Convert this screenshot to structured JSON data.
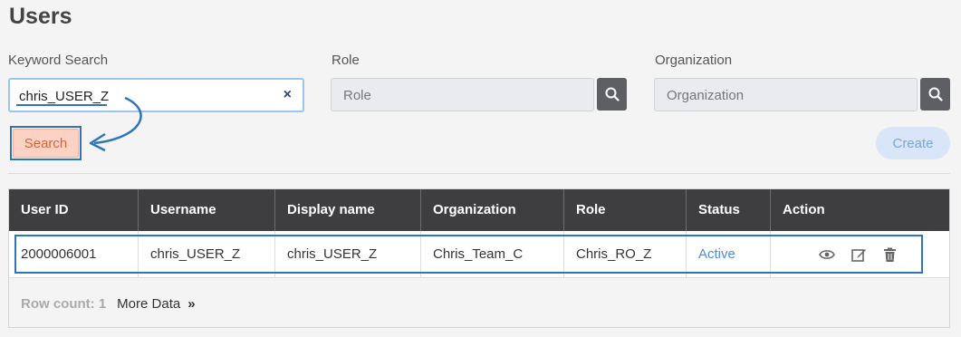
{
  "page": {
    "title": "Users"
  },
  "filters": {
    "keyword_label": "Keyword Search",
    "keyword_value": "chris_USER_Z",
    "clear_glyph": "×",
    "role_label": "Role",
    "role_placeholder": "Role",
    "org_label": "Organization",
    "org_placeholder": "Organization",
    "search_label": "Search",
    "create_label": "Create"
  },
  "table": {
    "headers": [
      "User ID",
      "Username",
      "Display name",
      "Organization",
      "Role",
      "Status",
      "Action"
    ],
    "rows": [
      {
        "user_id": "2000006001",
        "username": "chris_USER_Z",
        "display_name": "chris_USER_Z",
        "organization": "Chris_Team_C",
        "role": "Chris_RO_Z",
        "status": "Active"
      }
    ],
    "row_count_label": "Row count: 1",
    "more_data_label": "More Data",
    "more_data_glyph": "»"
  },
  "icons": {
    "clear": "close-icon",
    "lookup": "search-icon",
    "view": "eye-icon",
    "edit": "edit-icon",
    "delete": "trash-icon"
  },
  "colors": {
    "header_bg": "#3e3e40",
    "highlight": "#2f74b9",
    "status_active": "#4f8ad6",
    "search_btn_bg": "#fbd2c4",
    "create_btn_bg": "#d9e6f7"
  }
}
